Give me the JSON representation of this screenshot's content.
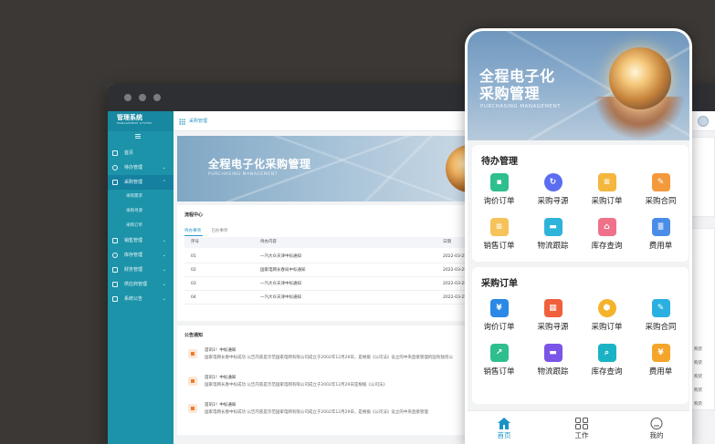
{
  "desktop": {
    "brand": {
      "title": "管理系统",
      "subtitle": "MANAGEMENT SYSTEM"
    },
    "breadcrumb": "采购管理",
    "nav": [
      {
        "label": "首页",
        "icon": "home-icon",
        "chevron": ""
      },
      {
        "label": "待办管理",
        "icon": "clock-icon",
        "chevron": "⌄"
      },
      {
        "label": "采购管理",
        "icon": "doc-icon",
        "chevron": "⌃",
        "active": true
      },
      {
        "label": "采购需求",
        "sub": true
      },
      {
        "label": "采购寻源",
        "sub": true
      },
      {
        "label": "采购订单",
        "sub": true
      },
      {
        "label": "销售管理",
        "icon": "users-icon",
        "chevron": "⌄"
      },
      {
        "label": "库存管理",
        "icon": "gear-icon",
        "chevron": "⌄"
      },
      {
        "label": "财务管理",
        "icon": "wallet-icon",
        "chevron": "⌄"
      },
      {
        "label": "供应商管理",
        "icon": "box-icon",
        "chevron": "⌄"
      },
      {
        "label": "系统公告",
        "icon": "speaker-icon",
        "chevron": "⌄"
      }
    ],
    "banner": {
      "title": "全程电子化采购管理",
      "subtitle": "PURCHASING MANAGEMENT"
    },
    "process": {
      "title": "流程中心",
      "tabs": [
        "待办事项",
        "已办事项"
      ],
      "columns": [
        "序号",
        "待办内容",
        "日期"
      ],
      "rows": [
        {
          "no": "01",
          "content": "一汽大众天津中标通知",
          "date": "2022-03-25"
        },
        {
          "no": "02",
          "content": "国家电网长春局中标通知",
          "date": "2022-03-25"
        },
        {
          "no": "03",
          "content": "一汽大众天津中标通知",
          "date": "2022-03-25"
        },
        {
          "no": "04",
          "content": "一汽大众天津中标通知",
          "date": "2022-03-25"
        }
      ]
    },
    "notices": {
      "title": "公告通知",
      "items": [
        {
          "title": "首讯1！中标通知",
          "desc": "国家电网长春中标成功 公告内容是示范国家电网有限公司成立于2002年12月29日，是根据《公司法》设立的中央直接管理的国有独资公"
        },
        {
          "title": "首讯1！中标通知",
          "desc": "国家电网长春中标成功 公告内容是示范国家电网有限公司成立于2002年12月29日是根据《公司法》"
        },
        {
          "title": "首讯1！中标通知",
          "desc": "国家电网长春中标成功 公告内容是示范国家电网有限公司成立于2002年12月29日，是根据《公司法》设立的中央直接管理"
        }
      ]
    },
    "right_labels": [
      "购货",
      "购货",
      "购货",
      "购货",
      "购货"
    ]
  },
  "mobile": {
    "banner": {
      "title_line1": "全程电子化",
      "title_line2": "采购管理",
      "subtitle": "PURCHASING MANAGEMENT"
    },
    "todo": {
      "title": "待办管理",
      "items": [
        {
          "label": "询价订单",
          "icon": "chat-icon",
          "color": "#2fbf8f"
        },
        {
          "label": "采购寻源",
          "icon": "refresh-icon",
          "color": "#5b6df0"
        },
        {
          "label": "采购订单",
          "icon": "clipboard-icon",
          "color": "#f4b63d"
        },
        {
          "label": "采购合同",
          "icon": "edit-doc-icon",
          "color": "#f39a3c"
        },
        {
          "label": "销售订单",
          "icon": "list-icon",
          "color": "#f6c25a"
        },
        {
          "label": "物流跟踪",
          "icon": "truck-icon",
          "color": "#2fb4d9"
        },
        {
          "label": "库存查询",
          "icon": "warehouse-icon",
          "color": "#f0718a"
        },
        {
          "label": "费用单",
          "icon": "bill-icon",
          "color": "#4a8de8"
        }
      ]
    },
    "orders": {
      "title": "采购订单",
      "items": [
        {
          "label": "询价订单",
          "icon": "yen-icon",
          "color": "#2a88e6"
        },
        {
          "label": "采购寻源",
          "icon": "grid-chart-icon",
          "color": "#f0603c"
        },
        {
          "label": "采购订单",
          "icon": "hexagon-icon",
          "color": "#f4b32a"
        },
        {
          "label": "采购合同",
          "icon": "pen-doc-icon",
          "color": "#2ab0e0"
        },
        {
          "label": "销售订单",
          "icon": "line-chart-icon",
          "color": "#2fbf8f"
        },
        {
          "label": "物流跟踪",
          "icon": "truck-icon",
          "color": "#7a55e8"
        },
        {
          "label": "库存查询",
          "icon": "search-home-icon",
          "color": "#1ab3c6"
        },
        {
          "label": "费用单",
          "icon": "coins-icon",
          "color": "#f4a52a"
        }
      ]
    },
    "tabbar": [
      {
        "label": "首页",
        "icon": "home-icon",
        "active": true
      },
      {
        "label": "工作",
        "icon": "grid-icon"
      },
      {
        "label": "我的",
        "icon": "user-icon"
      }
    ]
  }
}
